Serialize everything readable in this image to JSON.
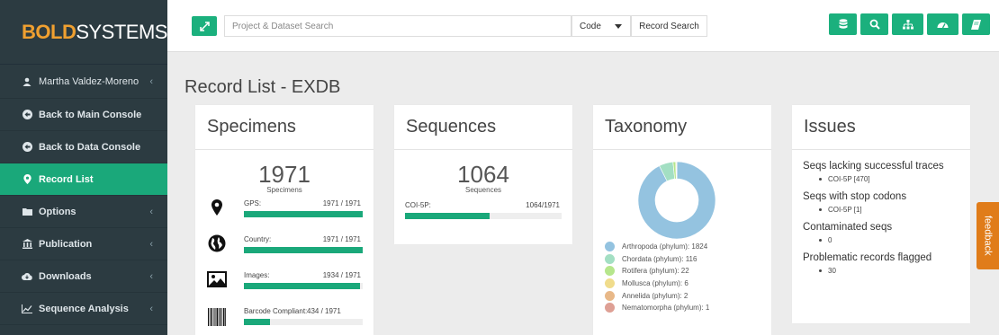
{
  "brand": {
    "part1": "BOLD",
    "part2": "SYSTEMS"
  },
  "sidebar": {
    "user": "Martha Valdez-Moreno",
    "items": [
      {
        "label": "Back to Main Console",
        "icon": "arrow-circle-left-icon"
      },
      {
        "label": "Back to Data Console",
        "icon": "arrow-circle-left-icon"
      },
      {
        "label": "Record List",
        "icon": "map-marker-icon"
      },
      {
        "label": "Options",
        "icon": "folder-icon"
      },
      {
        "label": "Publication",
        "icon": "bank-icon"
      },
      {
        "label": "Downloads",
        "icon": "cloud-download-icon"
      },
      {
        "label": "Sequence Analysis",
        "icon": "line-chart-icon"
      }
    ]
  },
  "topbar": {
    "search_placeholder": "Project & Dataset Search",
    "code_selected": "Code",
    "record_search": "Record Search"
  },
  "page": {
    "title": "Record List - EXDB"
  },
  "specimens": {
    "title": "Specimens",
    "count": "1971",
    "count_label": "Specimens",
    "stats": [
      {
        "label": "GPS:",
        "value": "1971 / 1971",
        "fraction": 1.0
      },
      {
        "label": "Country:",
        "value": "1971 / 1971",
        "fraction": 1.0
      },
      {
        "label": "Images:",
        "value": "1934 / 1971",
        "fraction": 0.981
      },
      {
        "label": "Barcode Compliant:",
        "value": "434 / 1971",
        "fraction": 0.22
      }
    ]
  },
  "sequences": {
    "title": "Sequences",
    "count": "1064",
    "count_label": "Sequences",
    "marker": {
      "label": "COI-5P:",
      "value": "1064/1971",
      "fraction": 0.54
    }
  },
  "taxonomy": {
    "title": "Taxonomy",
    "legend": [
      {
        "label": "Arthropoda (phylum): 1824",
        "color": "#94c3e0",
        "count": 1824
      },
      {
        "label": "Chordata (phylum): 116",
        "color": "#a3dfc3",
        "count": 116
      },
      {
        "label": "Rotifera (phylum): 22",
        "color": "#b6e68c",
        "count": 22
      },
      {
        "label": "Mollusca (phylum): 6",
        "color": "#f0dc8c",
        "count": 6
      },
      {
        "label": "Annelida (phylum): 2",
        "color": "#e8b888",
        "count": 2
      },
      {
        "label": "Nematomorpha (phylum): 1",
        "color": "#dea095",
        "count": 1
      }
    ]
  },
  "issues": {
    "title": "Issues",
    "groups": [
      {
        "title": "Seqs lacking successful traces",
        "item": "COI-5P [470]"
      },
      {
        "title": "Seqs with stop codons",
        "item": "COI-5P [1]"
      },
      {
        "title": "Contaminated seqs",
        "item": "0"
      },
      {
        "title": "Problematic records flagged",
        "item": "30"
      }
    ]
  },
  "feedback": "feedback",
  "colors": {
    "accent": "#1bb07d",
    "sidebar": "#2c3b41",
    "feedback": "#e07c1a"
  }
}
